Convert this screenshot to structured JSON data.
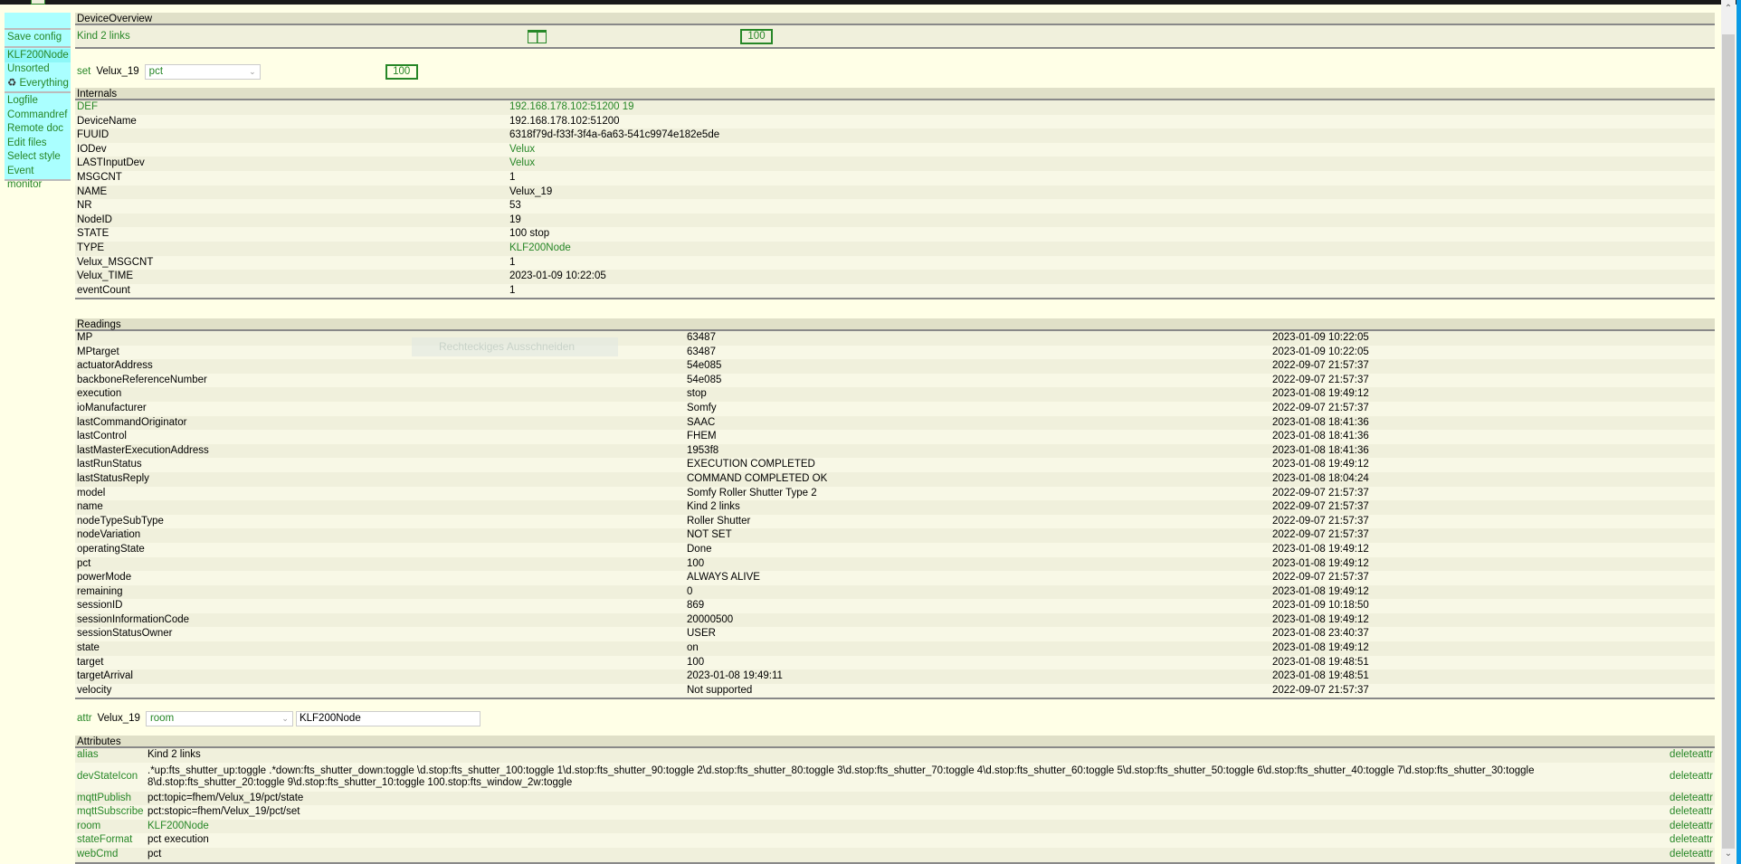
{
  "menu": {
    "items": [
      "Save config",
      "KLF200Node",
      "Unsorted",
      "Everything",
      "Logfile",
      "Commandref",
      "Remote doc",
      "Edit files",
      "Select style",
      "Event monitor"
    ]
  },
  "overview": {
    "title": "DeviceOverview",
    "device_alias": "Kind 2 links",
    "value": "100"
  },
  "set": {
    "label": "set",
    "device": "Velux_19",
    "selected": "pct",
    "value": "100"
  },
  "internals": {
    "title": "Internals",
    "rows": [
      [
        "DEF",
        "192.168.178.102:51200 19"
      ],
      [
        "DeviceName",
        "192.168.178.102:51200"
      ],
      [
        "FUUID",
        "6318f79d-f33f-3f4a-6a63-541c9974e182e5de"
      ],
      [
        "IODev",
        "Velux"
      ],
      [
        "LASTInputDev",
        "Velux"
      ],
      [
        "MSGCNT",
        "1"
      ],
      [
        "NAME",
        "Velux_19"
      ],
      [
        "NR",
        "53"
      ],
      [
        "NodeID",
        "19"
      ],
      [
        "STATE",
        "100 stop"
      ],
      [
        "TYPE",
        "KLF200Node"
      ],
      [
        "Velux_MSGCNT",
        "1"
      ],
      [
        "Velux_TIME",
        "2023-01-09 10:22:05"
      ],
      [
        "eventCount",
        "1"
      ]
    ]
  },
  "readings": {
    "title": "Readings",
    "rows": [
      [
        "MP",
        "63487",
        "2023-01-09 10:22:05"
      ],
      [
        "MPtarget",
        "63487",
        "2023-01-09 10:22:05"
      ],
      [
        "actuatorAddress",
        "54e085",
        "2022-09-07 21:57:37"
      ],
      [
        "backboneReferenceNumber",
        "54e085",
        "2022-09-07 21:57:37"
      ],
      [
        "execution",
        "stop",
        "2023-01-08 19:49:12"
      ],
      [
        "ioManufacturer",
        "Somfy",
        "2022-09-07 21:57:37"
      ],
      [
        "lastCommandOriginator",
        "SAAC",
        "2023-01-08 18:41:36"
      ],
      [
        "lastControl",
        "FHEM",
        "2023-01-08 18:41:36"
      ],
      [
        "lastMasterExecutionAddress",
        "1953f8",
        "2023-01-08 18:41:36"
      ],
      [
        "lastRunStatus",
        "EXECUTION COMPLETED",
        "2023-01-08 19:49:12"
      ],
      [
        "lastStatusReply",
        "COMMAND COMPLETED OK",
        "2023-01-08 18:04:24"
      ],
      [
        "model",
        "Somfy Roller Shutter Type 2",
        "2022-09-07 21:57:37"
      ],
      [
        "name",
        "Kind 2 links",
        "2022-09-07 21:57:37"
      ],
      [
        "nodeTypeSubType",
        "Roller Shutter",
        "2022-09-07 21:57:37"
      ],
      [
        "nodeVariation",
        "NOT SET",
        "2022-09-07 21:57:37"
      ],
      [
        "operatingState",
        "Done",
        "2023-01-08 19:49:12"
      ],
      [
        "pct",
        "100",
        "2023-01-08 19:49:12"
      ],
      [
        "powerMode",
        "ALWAYS ALIVE",
        "2022-09-07 21:57:37"
      ],
      [
        "remaining",
        "0",
        "2023-01-08 19:49:12"
      ],
      [
        "sessionID",
        "869",
        "2023-01-09 10:18:50"
      ],
      [
        "sessionInformationCode",
        "20000500",
        "2023-01-08 19:49:12"
      ],
      [
        "sessionStatusOwner",
        "USER",
        "2023-01-08 23:40:37"
      ],
      [
        "state",
        "on",
        "2023-01-08 19:49:12"
      ],
      [
        "target",
        "100",
        "2023-01-08 19:48:51"
      ],
      [
        "targetArrival",
        "2023-01-08 19:49:11",
        "2023-01-08 19:48:51"
      ],
      [
        "velocity",
        "Not supported",
        "2022-09-07 21:57:37"
      ]
    ]
  },
  "attr": {
    "label": "attr",
    "device": "Velux_19",
    "selected": "room",
    "value": "KLF200Node"
  },
  "attributes": {
    "title": "Attributes",
    "delete_label": "deleteattr",
    "rows": [
      [
        "alias",
        "Kind 2 links"
      ],
      [
        "devStateIcon",
        ".*up:fts_shutter_up:toggle .*down:fts_shutter_down:toggle \\d.stop:fts_shutter_100:toggle 1\\d.stop:fts_shutter_90:toggle 2\\d.stop:fts_shutter_80:toggle 3\\d.stop:fts_shutter_70:toggle 4\\d.stop:fts_shutter_60:toggle 5\\d.stop:fts_shutter_50:toggle 6\\d.stop:fts_shutter_40:toggle 7\\d.stop:fts_shutter_30:toggle 8\\d.stop:fts_shutter_20:toggle 9\\d.stop:fts_shutter_10:toggle 100.stop:fts_window_2w:toggle"
      ],
      [
        "mqttPublish",
        "pct:topic=fhem/Velux_19/pct/state"
      ],
      [
        "mqttSubscribe",
        "pct:stopic=fhem/Velux_19/pct/set"
      ],
      [
        "room",
        "KLF200Node"
      ],
      [
        "stateFormat",
        "pct execution"
      ],
      [
        "webCmd",
        "pct"
      ]
    ]
  },
  "overlay": {
    "text": "Rechteckiges Ausschneiden"
  }
}
